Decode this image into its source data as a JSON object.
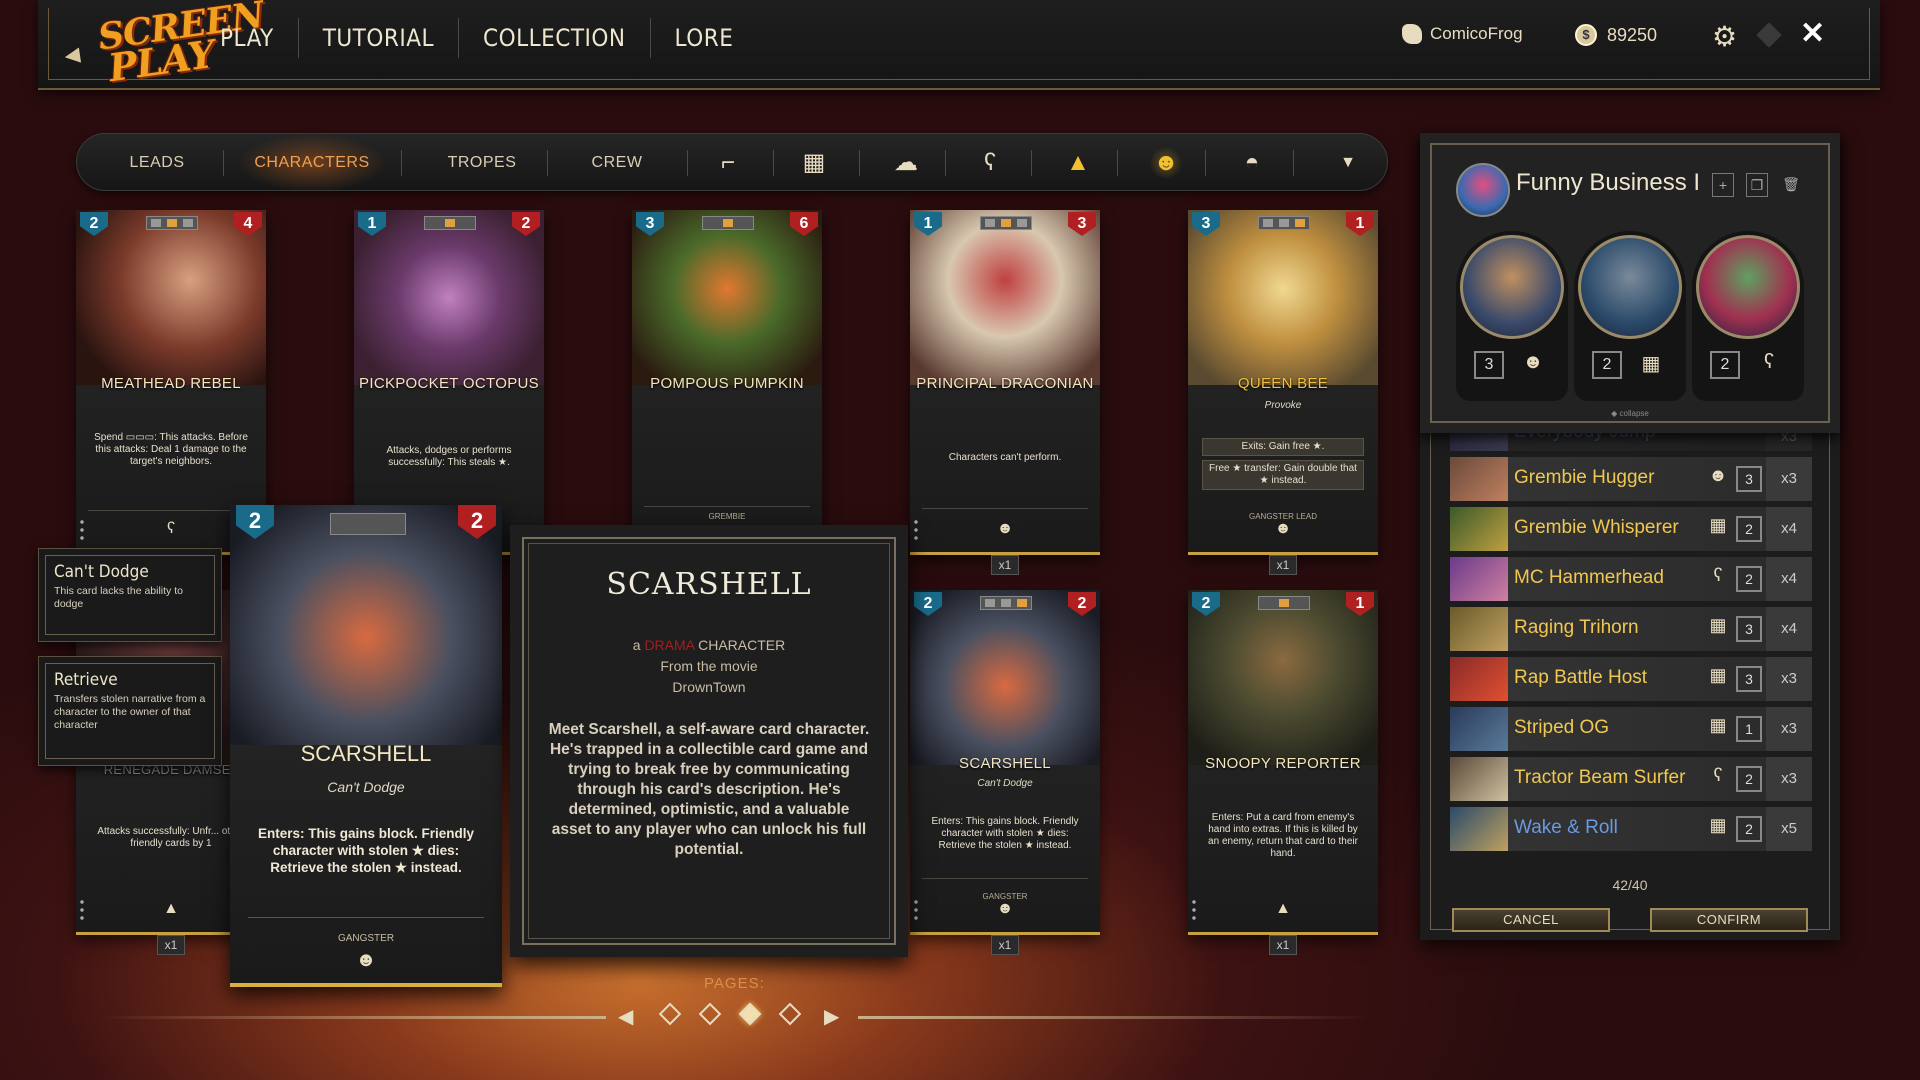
{
  "topbar": {
    "logo_line1": "SCREEN",
    "logo_line2": "PLAY",
    "nav": [
      "PLAY",
      "TUTORIAL",
      "COLLECTION",
      "LORE"
    ],
    "username": "ComicoFrog",
    "coins": "89250"
  },
  "filters": {
    "tabs": [
      "LEADS",
      "CHARACTERS",
      "TROPES",
      "CREW"
    ],
    "active_tab": "CHARACTERS",
    "icons": [
      "gun-icon",
      "map-icon",
      "ghost-icon",
      "bear-icon",
      "eye-triangle-icon",
      "drama-mask-icon",
      "ufo-icon"
    ],
    "selected_icon": "drama-mask-icon"
  },
  "cards": [
    {
      "name": "MEATHEAD REBEL",
      "cost": "2",
      "power": "4",
      "text": "Spend ▭▭▭: This attacks. Before this attacks: Deal 1 damage to the target's neighbors."
    },
    {
      "name": "PICKPOCKET OCTOPUS",
      "cost": "1",
      "power": "2",
      "text": "Attacks, dodges or performs successfully: This steals ★."
    },
    {
      "name": "POMPOUS PUMPKIN",
      "cost": "3",
      "power": "6",
      "text": "",
      "trope": "GREMBIE"
    },
    {
      "name": "PRINCIPAL DRACONIAN",
      "cost": "1",
      "power": "3",
      "text": "Characters can't perform.",
      "qty": "x1"
    },
    {
      "name": "QUEEN BEE",
      "cost": "3",
      "power": "1",
      "sub": "Provoke",
      "text1": "Exits: Gain free ★.",
      "text2": "Free ★ transfer: Gain double that ★ instead.",
      "trope": "GANGSTER LEAD",
      "qty": "x1"
    },
    {
      "name": "RENEGADE DAMSEL",
      "text": "Attacks successfully: Unfr... other friendly cards by 1",
      "qty": "x1"
    },
    {
      "name": "SCARSHELL",
      "cost": "2",
      "power": "2",
      "sub": "Can't Dodge",
      "text": "Enters: This gains block. Friendly character with stolen ★ dies: Retrieve the stolen ★ instead.",
      "trope": "GANGSTER",
      "qty": "x1"
    },
    {
      "name": "SNOOPY REPORTER",
      "cost": "2",
      "power": "1",
      "text": "Enters: Put a card from enemy's hand into extras. If this is killed by an enemy, return that card to their hand.",
      "qty": "x1"
    }
  ],
  "tooltips": [
    {
      "title": "Can't Dodge",
      "text": "This card lacks the ability to dodge"
    },
    {
      "title": "Retrieve",
      "text": "Transfers stolen narrative from a character to the owner of that character"
    }
  ],
  "big_card": {
    "name": "SCARSHELL",
    "cost": "2",
    "power": "2",
    "sub": "Can't Dodge",
    "text": "Enters: This gains block. Friendly character with stolen ★ dies: Retrieve the stolen ★ instead.",
    "trope": "GANGSTER"
  },
  "lore": {
    "title": "SCARSHELL",
    "line_a": "a",
    "line_genre": "DRAMA",
    "line_b": "CHARACTER",
    "from": "From the movie",
    "movie": "DrownTown",
    "description": "Meet Scarshell, a self-aware card character. He's trapped in a collectible card game and trying to break free by communicating through his card's description. He's determined, optimistic, and a valuable asset to any player who can unlock his full potential."
  },
  "pages": {
    "label": "PAGES:",
    "count": 4,
    "current": 3
  },
  "deck": {
    "name": "Funny Business I",
    "leads": [
      {
        "cost": "3",
        "icon": "drama-mask-icon"
      },
      {
        "cost": "2",
        "icon": "map-icon"
      },
      {
        "cost": "2",
        "icon": "bear-icon"
      }
    ],
    "collapse_label": "collapse",
    "list": [
      {
        "name": "Everybody Jump",
        "icon": "map-icon",
        "cost": "2",
        "qty": "x3",
        "faded": true
      },
      {
        "name": "Grembie Hugger",
        "icon": "drama-mask-icon",
        "cost": "3",
        "qty": "x3"
      },
      {
        "name": "Grembie Whisperer",
        "icon": "map-icon",
        "cost": "2",
        "qty": "x4"
      },
      {
        "name": "MC Hammerhead",
        "icon": "bear-icon",
        "cost": "2",
        "qty": "x4"
      },
      {
        "name": "Raging Trihorn",
        "icon": "map-icon",
        "cost": "3",
        "qty": "x4"
      },
      {
        "name": "Rap Battle Host",
        "icon": "map-icon",
        "cost": "3",
        "qty": "x3"
      },
      {
        "name": "Striped OG",
        "icon": "map-icon",
        "cost": "1",
        "qty": "x3"
      },
      {
        "name": "Tractor Beam Surfer",
        "icon": "bear-icon",
        "cost": "2",
        "qty": "x3"
      },
      {
        "name": "Wake & Roll",
        "icon": "map-icon",
        "cost": "2",
        "qty": "x5",
        "blue": true
      }
    ],
    "count": "42/40",
    "cancel": "CANCEL",
    "confirm": "CONFIRM"
  }
}
